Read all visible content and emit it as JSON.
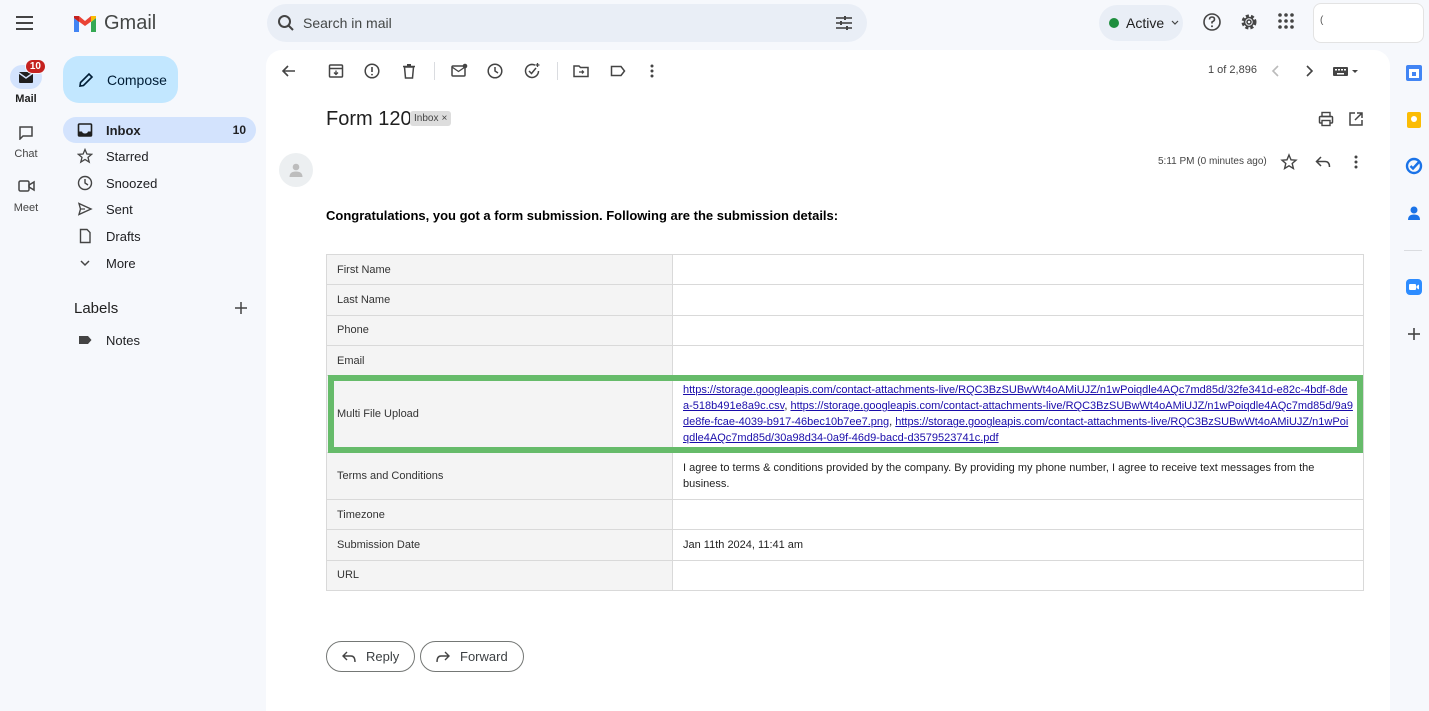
{
  "rail": {
    "items": [
      {
        "label": "Mail",
        "badge": "10"
      },
      {
        "label": "Chat"
      },
      {
        "label": "Meet"
      }
    ]
  },
  "app": {
    "name": "Gmail"
  },
  "search": {
    "placeholder": "Search in mail"
  },
  "status": {
    "label": "Active"
  },
  "account": {
    "text": "("
  },
  "sidebar": {
    "compose": "Compose",
    "items": [
      {
        "label": "Inbox",
        "count": "10"
      },
      {
        "label": "Starred"
      },
      {
        "label": "Snoozed"
      },
      {
        "label": "Sent"
      },
      {
        "label": "Drafts"
      },
      {
        "label": "More"
      }
    ],
    "labels_heading": "Labels",
    "labels": [
      {
        "label": "Notes"
      }
    ]
  },
  "toolbar": {
    "pager": "1 of 2,896"
  },
  "email": {
    "subject": "Form 120",
    "chip": "Inbox",
    "time": "5:11 PM (0 minutes ago)",
    "intro": "Congratulations, you got a form submission. Following are the submission details:",
    "rows": [
      {
        "key": "First Name",
        "value": ""
      },
      {
        "key": "Last Name",
        "value": ""
      },
      {
        "key": "Phone",
        "value": ""
      },
      {
        "key": "Email",
        "value": ""
      },
      {
        "key": "Multi File Upload",
        "links": [
          "https://storage.googleapis.com/contact-attachments-live/RQC3BzSUBwWt4oAMiUJZ/n1wPoiqdle4AQc7md85d/32fe341d-e82c-4bdf-8dea-518b491e8a9c.csv",
          "https://storage.googleapis.com/contact-attachments-live/RQC3BzSUBwWt4oAMiUJZ/n1wPoiqdle4AQc7md85d/9a9de8fe-fcae-4039-b917-46bec10b7ee7.png",
          "https://storage.googleapis.com/contact-attachments-live/RQC3BzSUBwWt4oAMiUJZ/n1wPoiqdle4AQc7md85d/30a98d34-0a9f-46d9-bacd-d3579523741c.pdf"
        ]
      },
      {
        "key": "Terms and Conditions",
        "value": "I agree to terms & conditions provided by the company. By providing my phone number, I agree to receive text messages from the business."
      },
      {
        "key": "Timezone",
        "value": ""
      },
      {
        "key": "Submission Date",
        "value": "Jan 11th 2024, 11:41 am"
      },
      {
        "key": "URL",
        "value": ""
      }
    ],
    "reply": "Reply",
    "forward": "Forward"
  },
  "colors": {
    "highlight": "#66bb6a",
    "accent": "#c2e7ff",
    "active_nav": "#d3e3fd",
    "badge": "#c5221f"
  }
}
